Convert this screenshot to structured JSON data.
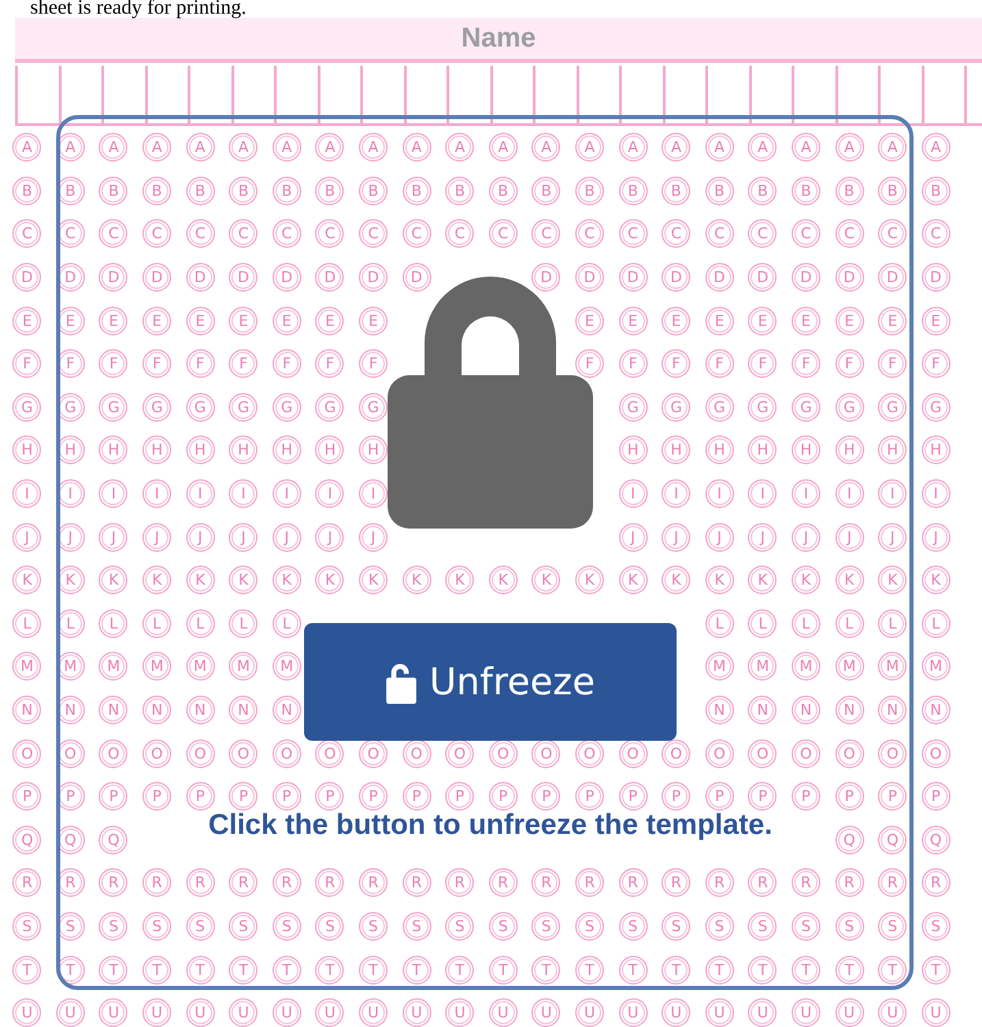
{
  "intro_text": "sheet is ready for printing.",
  "name_section": {
    "title": "Name"
  },
  "bubble_rows": [
    {
      "left": [
        "A",
        "A",
        "A",
        "A",
        "A",
        "A",
        "A",
        "A",
        "A",
        "A",
        "A",
        "A",
        "A",
        "A",
        "A",
        "A",
        "A",
        "A",
        "A",
        "A",
        "A",
        "A"
      ]
    },
    {
      "left": [
        "B",
        "B",
        "B",
        "B",
        "B",
        "B",
        "B",
        "B",
        "B",
        "B",
        "B",
        "B",
        "B",
        "B",
        "B",
        "B",
        "B",
        "B",
        "B",
        "B",
        "B",
        "B"
      ]
    },
    {
      "left": [
        "C",
        "C",
        "C",
        "C",
        "C",
        "C",
        "C",
        "C",
        "C",
        "C",
        "C",
        "C",
        "C",
        "C",
        "C",
        "C",
        "C",
        "C",
        "C",
        "C",
        "C",
        "C"
      ]
    },
    {
      "left": [
        "D",
        "D",
        "D",
        "D",
        "D",
        "D",
        "D",
        "D",
        "D",
        "D"
      ],
      "right": [
        "D",
        "D",
        "D",
        "D",
        "D",
        "D",
        "D",
        "D",
        "D",
        "D"
      ]
    },
    {
      "left": [
        "E",
        "E",
        "E",
        "E",
        "E",
        "E",
        "E",
        "E",
        "E"
      ],
      "right": [
        "E",
        "E",
        "E",
        "E",
        "E",
        "E",
        "E",
        "E",
        "E"
      ]
    },
    {
      "left": [
        "F",
        "F",
        "F",
        "F",
        "F",
        "F",
        "F",
        "F",
        "F"
      ],
      "right": [
        "F",
        "F",
        "F",
        "F",
        "F",
        "F",
        "F",
        "F",
        "F"
      ]
    },
    {
      "left": [
        "G",
        "G",
        "G",
        "G",
        "G",
        "G",
        "G",
        "G",
        "G"
      ],
      "right": [
        "G",
        "G",
        "G",
        "G",
        "G",
        "G",
        "G",
        "G"
      ]
    },
    {
      "left": [
        "H",
        "H",
        "H",
        "H",
        "H",
        "H",
        "H",
        "H",
        "H"
      ],
      "right": [
        "H",
        "H",
        "H",
        "H",
        "H",
        "H",
        "H",
        "H"
      ]
    },
    {
      "left": [
        "I",
        "I",
        "I",
        "I",
        "I",
        "I",
        "I",
        "I",
        "I"
      ],
      "right": [
        "I",
        "I",
        "I",
        "I",
        "I",
        "I",
        "I",
        "I"
      ]
    },
    {
      "left": [
        "J",
        "J",
        "J",
        "J",
        "J",
        "J",
        "J",
        "J",
        "J"
      ],
      "right": [
        "J",
        "J",
        "J",
        "J",
        "J",
        "J",
        "J",
        "J"
      ]
    },
    {
      "left": [
        "K",
        "K",
        "K",
        "K",
        "K",
        "K",
        "K",
        "K",
        "K",
        "K",
        "K",
        "K",
        "K",
        "K",
        "K",
        "K",
        "K",
        "K",
        "K",
        "K",
        "K",
        "K"
      ]
    },
    {
      "left": [
        "L",
        "L",
        "L",
        "L",
        "L",
        "L",
        "L"
      ],
      "right": [
        "L",
        "L",
        "L",
        "L",
        "L",
        "L"
      ]
    },
    {
      "left": [
        "M",
        "M",
        "M",
        "M",
        "M",
        "M",
        "M"
      ],
      "right": [
        "M",
        "M",
        "M",
        "M",
        "M",
        "M"
      ]
    },
    {
      "left": [
        "N",
        "N",
        "N",
        "N",
        "N",
        "N",
        "N"
      ],
      "right": [
        "N",
        "N",
        "N",
        "N",
        "N",
        "N"
      ]
    },
    {
      "left": [
        "O",
        "O",
        "O",
        "O",
        "O",
        "O",
        "O",
        "O",
        "O",
        "O",
        "O",
        "O",
        "O",
        "O",
        "O",
        "O",
        "O",
        "O",
        "O",
        "O",
        "O",
        "O"
      ]
    },
    {
      "left": [
        "P",
        "P",
        "P",
        "P",
        "P",
        "P",
        "P",
        "P",
        "P",
        "P",
        "P",
        "P",
        "P",
        "P",
        "P",
        "P",
        "P",
        "P",
        "P",
        "P",
        "P",
        "P"
      ]
    },
    {
      "left": [
        "Q",
        "Q",
        "Q"
      ],
      "right": [
        "Q",
        "Q",
        "Q"
      ]
    },
    {
      "left": [
        "R",
        "R",
        "R",
        "R",
        "R",
        "R",
        "R",
        "R",
        "R",
        "R",
        "R",
        "R",
        "R",
        "R",
        "R",
        "R",
        "R",
        "R",
        "R",
        "R",
        "R",
        "R"
      ]
    },
    {
      "left": [
        "S",
        "S",
        "S",
        "S",
        "S",
        "S",
        "S",
        "S",
        "S",
        "S",
        "S",
        "S",
        "S",
        "S",
        "S",
        "S",
        "S",
        "S",
        "S",
        "S",
        "S",
        "S"
      ]
    },
    {
      "left": [
        "T",
        "T",
        "T",
        "T",
        "T",
        "T",
        "T",
        "T",
        "T",
        "T",
        "T",
        "T",
        "T",
        "T",
        "T",
        "T",
        "T",
        "T",
        "T",
        "T",
        "T",
        "T"
      ]
    },
    {
      "left": [
        "U",
        "U",
        "U",
        "U",
        "U",
        "U",
        "U",
        "U",
        "U",
        "U",
        "U",
        "U",
        "U",
        "U",
        "U",
        "U",
        "U",
        "U",
        "U",
        "U",
        "U",
        "U"
      ]
    }
  ],
  "freeze_overlay": {
    "button": "Unfreeze",
    "message": "Click the button to unfreeze the template."
  }
}
